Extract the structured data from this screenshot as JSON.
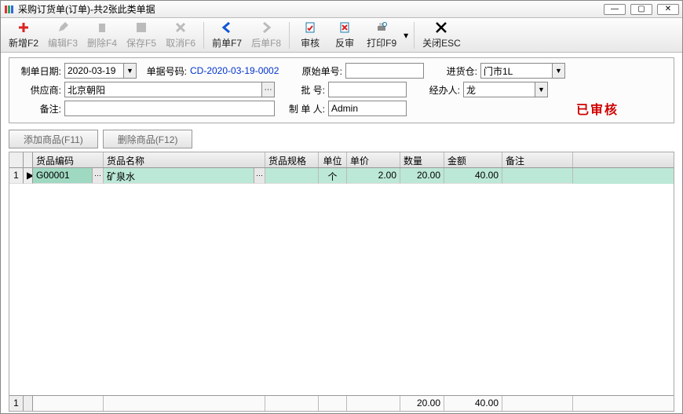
{
  "window": {
    "title": "采购订货单(订单)-共2张此类单据"
  },
  "toolbar": {
    "new": "新增F2",
    "edit": "编辑F3",
    "delete": "删除F4",
    "save": "保存F5",
    "cancel": "取消F6",
    "prev": "前单F7",
    "next": "后单F8",
    "audit": "审核",
    "unaudit": "反审",
    "print": "打印F9",
    "close": "关闭ESC"
  },
  "form": {
    "orderDateLabel": "制单日期:",
    "orderDate": "2020-03-19",
    "docNoLabel": "单据号码:",
    "docNo": "CD-2020-03-19-0002",
    "origNoLabel": "原始单号:",
    "origNo": "",
    "warehouseLabel": "进货仓:",
    "warehouse": "门市1L",
    "supplierLabel": "供应商:",
    "supplier": "北京朝阳",
    "batchLabel": "批    号:",
    "batch": "",
    "handlerLabel": "经办人:",
    "handler": "龙",
    "remarkLabel": "备注:",
    "remark": "",
    "makerLabel": "制 单 人:",
    "maker": "Admin",
    "auditStamp": "已审核"
  },
  "buttons": {
    "addGoods": "添加商品(F11)",
    "delGoods": "删除商品(F12)"
  },
  "grid": {
    "headers": {
      "code": "货品编码",
      "name": "货品名称",
      "spec": "货品规格",
      "unit": "单位",
      "price": "单价",
      "qty": "数量",
      "amount": "金额",
      "note": "备注"
    },
    "rows": [
      {
        "rownum": "1",
        "code": "G00001",
        "name": "矿泉水",
        "spec": "",
        "unit": "个",
        "price": "2.00",
        "qty": "20.00",
        "amount": "40.00",
        "note": ""
      }
    ],
    "footer": {
      "rownum": "1",
      "qty": "20.00",
      "amount": "40.00"
    }
  }
}
